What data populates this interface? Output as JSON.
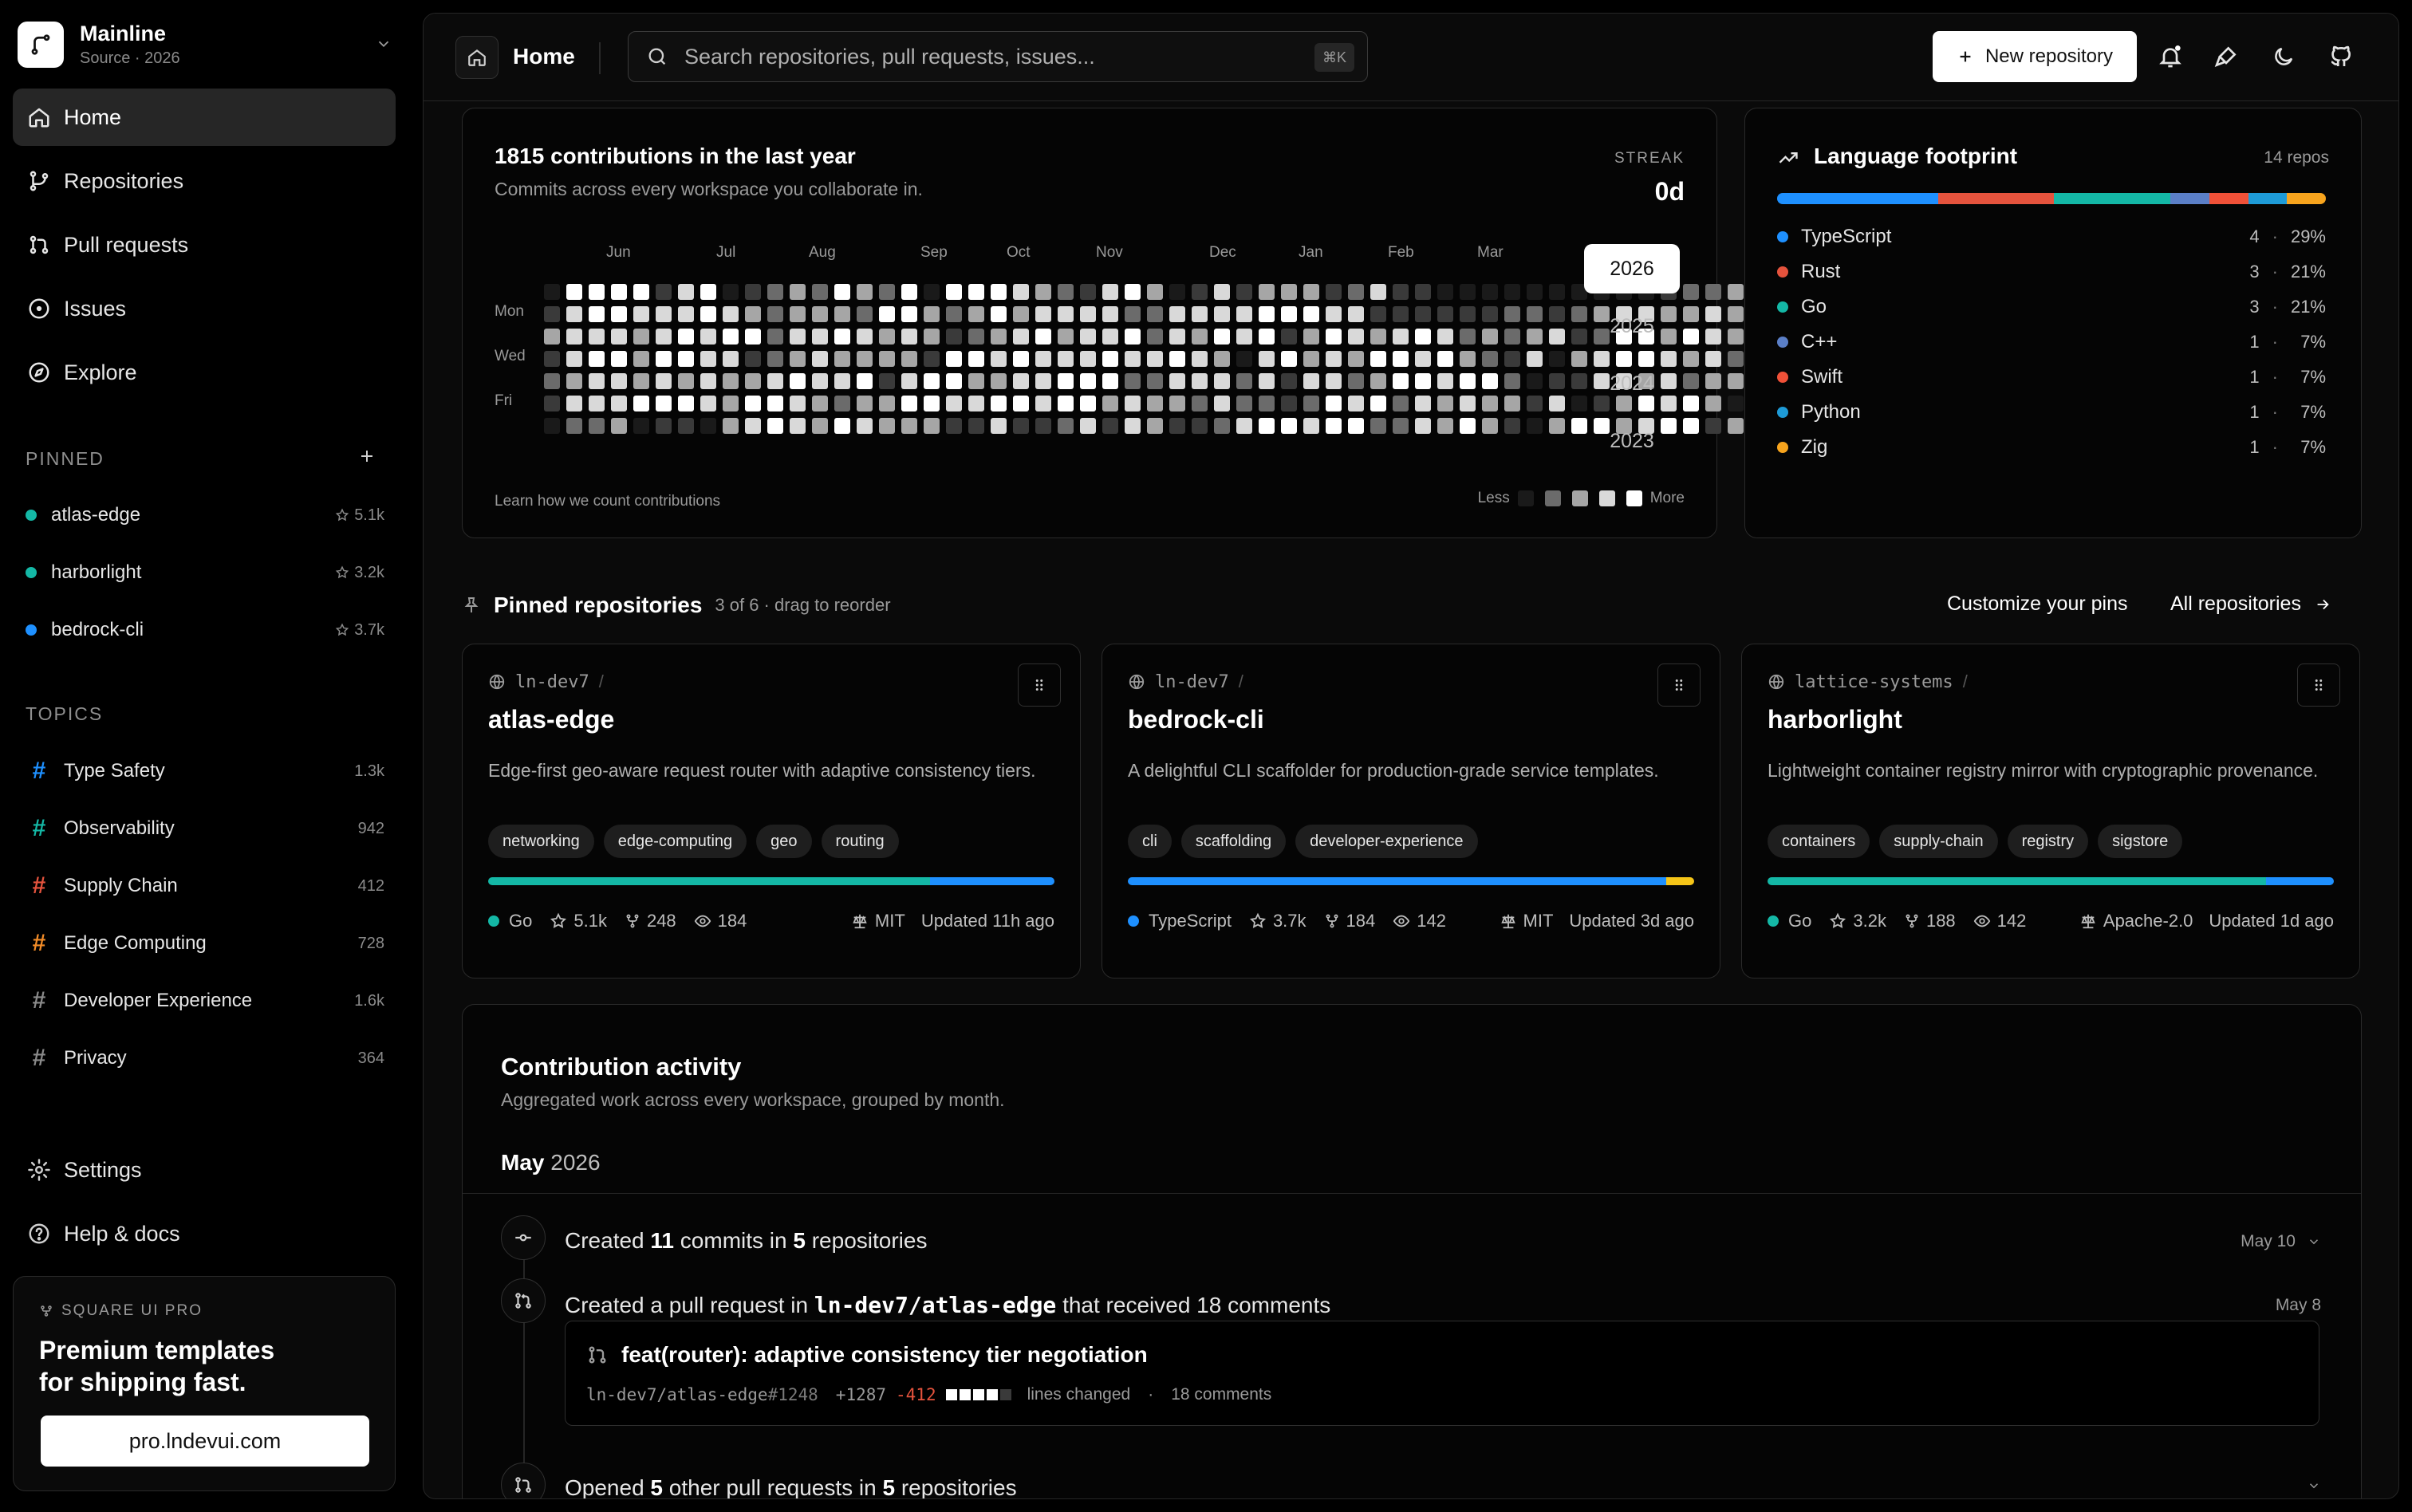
{
  "workspace": {
    "name": "Mainline",
    "sub": "Source · 2026"
  },
  "nav": [
    {
      "label": "Home",
      "icon": "home-icon",
      "active": true
    },
    {
      "label": "Repositories",
      "icon": "branch-icon"
    },
    {
      "label": "Pull requests",
      "icon": "pull-request-icon"
    },
    {
      "label": "Issues",
      "icon": "issue-icon"
    },
    {
      "label": "Explore",
      "icon": "compass-icon"
    }
  ],
  "pinned": {
    "heading": "PINNED",
    "items": [
      {
        "name": "atlas-edge",
        "stars": "5.1k",
        "color": "#14b8a6"
      },
      {
        "name": "harborlight",
        "stars": "3.2k",
        "color": "#14b8a6"
      },
      {
        "name": "bedrock-cli",
        "stars": "3.7k",
        "color": "#1e90ff"
      }
    ]
  },
  "topics": {
    "heading": "TOPICS",
    "items": [
      {
        "name": "Type Safety",
        "count": "1.3k",
        "color": "#1e90ff"
      },
      {
        "name": "Observability",
        "count": "942",
        "color": "#14b8a6"
      },
      {
        "name": "Supply Chain",
        "count": "412",
        "color": "#e5533d"
      },
      {
        "name": "Edge Computing",
        "count": "728",
        "color": "#f28c28"
      },
      {
        "name": "Developer Experience",
        "count": "1.6k",
        "color": "#8a8a8a"
      },
      {
        "name": "Privacy",
        "count": "364",
        "color": "#8a8a8a"
      }
    ]
  },
  "footer_nav": [
    {
      "label": "Settings",
      "icon": "gear-icon"
    },
    {
      "label": "Help & docs",
      "icon": "help-icon"
    }
  ],
  "promo": {
    "tag": "SQUARE UI PRO",
    "title": "Premium templates for shipping fast.",
    "button": "pro.lndevui.com"
  },
  "topbar": {
    "title": "Home",
    "search_placeholder": "Search repositories, pull requests, issues...",
    "shortcut": "⌘K",
    "new_repo": "New repository"
  },
  "contributions": {
    "title": "1815 contributions in the last year",
    "subtitle": "Commits across every workspace you collaborate in.",
    "streak_label": "STREAK",
    "streak_value": "0d",
    "months": [
      "Jun",
      "Jul",
      "Aug",
      "Sep",
      "Oct",
      "Nov",
      "Dec",
      "Jan",
      "Feb",
      "Mar"
    ],
    "days": [
      "Mon",
      "Wed",
      "Fri"
    ],
    "years": [
      "2026",
      "2025",
      "2024",
      "2023"
    ],
    "selected_year": "2026",
    "learn": "Learn how we count contributions",
    "less": "Less",
    "more": "More",
    "palette": [
      "#1a1a1a",
      "#3a3a3a",
      "#6b6b6b",
      "#a6a6a6",
      "#d9d9d9",
      "#ffffff"
    ],
    "levels": [
      "0555514501232532505554321453014133312411000000000012234",
      "1455444543233325532353444422444455544111111221234433431",
      "3444345455244543431234534452435451354345423234125535430",
      "1455355441234333315545444544543045343554532140345543424",
      "2344343433454451455334455522444241442355455201144342334",
      "1444555435543233554455455343324221254524343314013545302",
      "0223011034543543331141124143112455455224353103553455131"
    ]
  },
  "languages": {
    "title": "Language footprint",
    "count": "14 repos",
    "items": [
      {
        "name": "TypeScript",
        "repos": "4",
        "pct": "29%",
        "share": 29,
        "color": "#1e90ff"
      },
      {
        "name": "Rust",
        "repos": "3",
        "pct": "21%",
        "share": 21,
        "color": "#e5533d"
      },
      {
        "name": "Go",
        "repos": "3",
        "pct": "21%",
        "share": 21,
        "color": "#14b8a6"
      },
      {
        "name": "C++",
        "repos": "1",
        "pct": "7%",
        "share": 7,
        "color": "#5b7fc7"
      },
      {
        "name": "Swift",
        "repos": "1",
        "pct": "7%",
        "share": 7,
        "color": "#f05138"
      },
      {
        "name": "Python",
        "repos": "1",
        "pct": "7%",
        "share": 7,
        "color": "#1e9bd7"
      },
      {
        "name": "Zig",
        "repos": "1",
        "pct": "7%",
        "share": 7,
        "color": "#f7a41d"
      }
    ]
  },
  "pinned_repos": {
    "title": "Pinned repositories",
    "sub": "3 of 6 · drag to reorder",
    "customize": "Customize your pins",
    "all": "All repositories",
    "cards": [
      {
        "owner": "ln-dev7",
        "name": "atlas-edge",
        "desc": "Edge-first geo-aware request router with adaptive consistency tiers.",
        "tags": [
          "networking",
          "edge-computing",
          "geo",
          "routing"
        ],
        "lang": "Go",
        "lang_color": "#14b8a6",
        "stars": "5.1k",
        "forks": "248",
        "watchers": "184",
        "license": "MIT",
        "updated": "Updated 11h ago",
        "bar": [
          {
            "share": 78,
            "color": "#14b8a6"
          },
          {
            "share": 22,
            "color": "#1e90ff"
          }
        ]
      },
      {
        "owner": "ln-dev7",
        "name": "bedrock-cli",
        "desc": "A delightful CLI scaffolder for production-grade service templates.",
        "tags": [
          "cli",
          "scaffolding",
          "developer-experience"
        ],
        "lang": "TypeScript",
        "lang_color": "#1e90ff",
        "stars": "3.7k",
        "forks": "184",
        "watchers": "142",
        "license": "MIT",
        "updated": "Updated 3d ago",
        "bar": [
          {
            "share": 95,
            "color": "#1e90ff"
          },
          {
            "share": 5,
            "color": "#f5c518"
          }
        ]
      },
      {
        "owner": "lattice-systems",
        "name": "harborlight",
        "desc": "Lightweight container registry mirror with cryptographic provenance.",
        "tags": [
          "containers",
          "supply-chain",
          "registry",
          "sigstore"
        ],
        "lang": "Go",
        "lang_color": "#14b8a6",
        "stars": "3.2k",
        "forks": "188",
        "watchers": "142",
        "license": "Apache-2.0",
        "updated": "Updated 1d ago",
        "bar": [
          {
            "share": 88,
            "color": "#14b8a6"
          },
          {
            "share": 12,
            "color": "#1e90ff"
          }
        ]
      }
    ]
  },
  "activity": {
    "title": "Contribution activity",
    "sub": "Aggregated work across every workspace, grouped by month.",
    "month": "May",
    "year": "2026",
    "row1": {
      "a": "Created ",
      "b": "11",
      "c": " commits in ",
      "d": "5",
      "e": " repositories",
      "date": "May 10"
    },
    "row2": {
      "a": "Created a pull request in ",
      "repo": "ln-dev7/atlas-edge",
      "b": " that received 18 comments",
      "date": "May 8"
    },
    "pr": {
      "title": "feat(router): adaptive consistency tier negotiation",
      "ref": "ln-dev7/atlas-edge",
      "num": "#1248",
      "add": "+1287",
      "del": "-412",
      "lines": "lines changed",
      "sep": "·",
      "comments": "18 comments"
    },
    "row3": {
      "a": "Opened ",
      "b": "5",
      "c": " other pull requests in ",
      "d": "5",
      "e": " repositories"
    }
  }
}
